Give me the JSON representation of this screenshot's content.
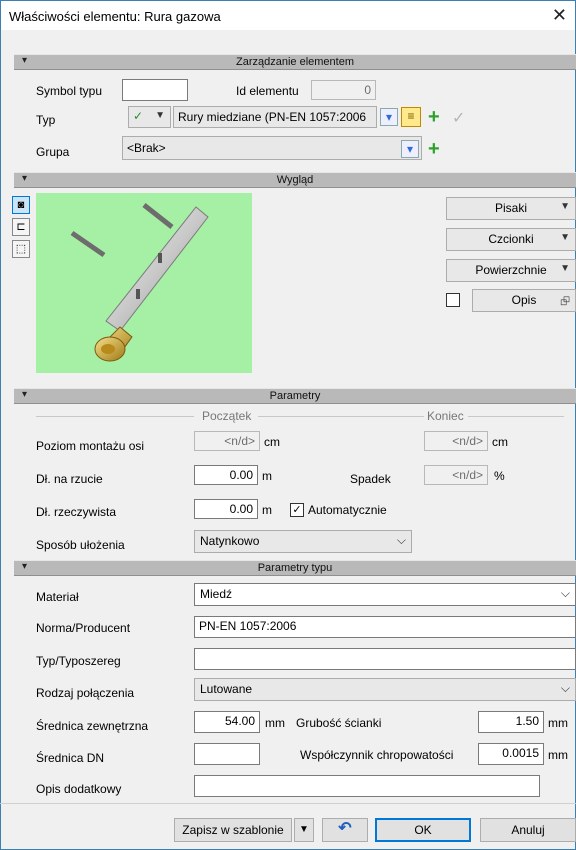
{
  "window": {
    "title": "Właściwości elementu: Rura gazowa",
    "close_glyph": "✕"
  },
  "sections": {
    "management": "Zarządzanie elementem",
    "appearance": "Wygląd",
    "parameters": "Parametry",
    "type_parameters": "Parametry typu"
  },
  "management": {
    "symbol_label": "Symbol typu",
    "symbol_value": "",
    "id_label": "Id elementu",
    "id_value": "0",
    "type_label": "Typ",
    "type_value": "Rury miedziane (PN-EN 1057:2006",
    "group_label": "Grupa",
    "group_value": "<Brak>"
  },
  "appearance": {
    "pens": "Pisaki",
    "fonts": "Czcionki",
    "surfaces": "Powierzchnie",
    "description": "Opis"
  },
  "parameters": {
    "start_label": "Początek",
    "end_label": "Koniec",
    "axis_level_label": "Poziom montażu osi",
    "axis_level_start": "<n/d>",
    "axis_level_start_unit": "cm",
    "axis_level_end": "<n/d>",
    "axis_level_end_unit": "cm",
    "projection_len_label": "Dł. na rzucie",
    "projection_len_value": "0.00",
    "projection_len_unit": "m",
    "slope_label": "Spadek",
    "slope_value": "<n/d>",
    "slope_unit": "%",
    "real_len_label": "Dł. rzeczywista",
    "real_len_value": "0.00",
    "real_len_unit": "m",
    "automatic_label": "Automatycznie",
    "automatic_checked": true,
    "laying_label": "Sposób ułożenia",
    "laying_value": "Natynkowo"
  },
  "type_params": {
    "material_label": "Materiał",
    "material_value": "Miedź",
    "norm_label": "Norma/Producent",
    "norm_value": "PN-EN 1057:2006",
    "series_label": "Typ/Typoszereg",
    "series_value": "",
    "connection_label": "Rodzaj połączenia",
    "connection_value": "Lutowane",
    "outer_diam_label": "Średnica zewnętrzna",
    "outer_diam_value": "54.00",
    "outer_diam_unit": "mm",
    "wall_label": "Grubość ścianki",
    "wall_value": "1.50",
    "wall_unit": "mm",
    "dn_label": "Średnica DN",
    "dn_value": "",
    "rough_label": "Współczynnik chropowatości",
    "rough_value": "0.0015",
    "rough_unit": "mm",
    "extra_label": "Opis dodatkowy",
    "extra_value": ""
  },
  "footer": {
    "save_template": "Zapisz w szablonie",
    "ok": "OK",
    "cancel": "Anuluj"
  },
  "colors": {
    "accent": "#0078d7",
    "plus": "#2fa12b",
    "preview_bg": "#a6f0a6"
  }
}
